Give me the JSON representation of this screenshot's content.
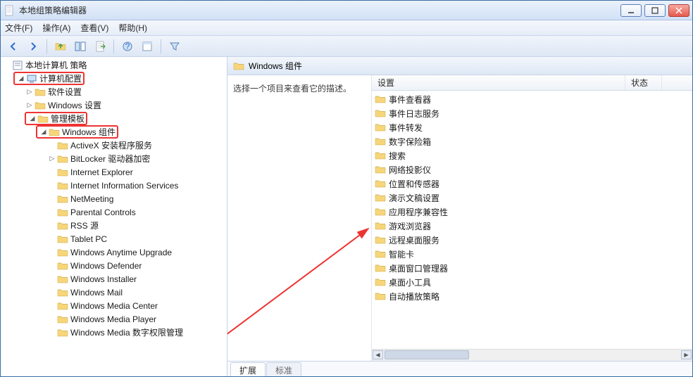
{
  "window": {
    "title": "本地组策略编辑器"
  },
  "menu": {
    "file": "文件(F)",
    "action": "操作(A)",
    "view": "查看(V)",
    "help": "帮助(H)"
  },
  "tree": {
    "root": "本地计算机 策略",
    "computer_config": "计算机配置",
    "software_settings": "软件设置",
    "windows_settings": "Windows 设置",
    "admin_templates": "管理模板",
    "windows_components": "Windows 组件",
    "children": [
      "ActiveX 安装程序服务",
      "BitLocker 驱动器加密",
      "Internet Explorer",
      "Internet Information Services",
      "NetMeeting",
      "Parental Controls",
      "RSS 源",
      "Tablet PC",
      "Windows Anytime Upgrade",
      "Windows Defender",
      "Windows Installer",
      "Windows Mail",
      "Windows Media Center",
      "Windows Media Player",
      "Windows Media 数字权限管理"
    ]
  },
  "right": {
    "header": "Windows 组件",
    "desc": "选择一个项目来查看它的描述。",
    "col_setting": "设置",
    "col_state": "状态",
    "items": [
      "事件查看器",
      "事件日志服务",
      "事件转发",
      "数字保险箱",
      "搜索",
      "网络投影仪",
      "位置和传感器",
      "演示文稿设置",
      "应用程序兼容性",
      "游戏浏览器",
      "远程桌面服务",
      "智能卡",
      "桌面窗口管理器",
      "桌面小工具",
      "自动播放策略"
    ],
    "tab_ext": "扩展",
    "tab_std": "标准"
  }
}
